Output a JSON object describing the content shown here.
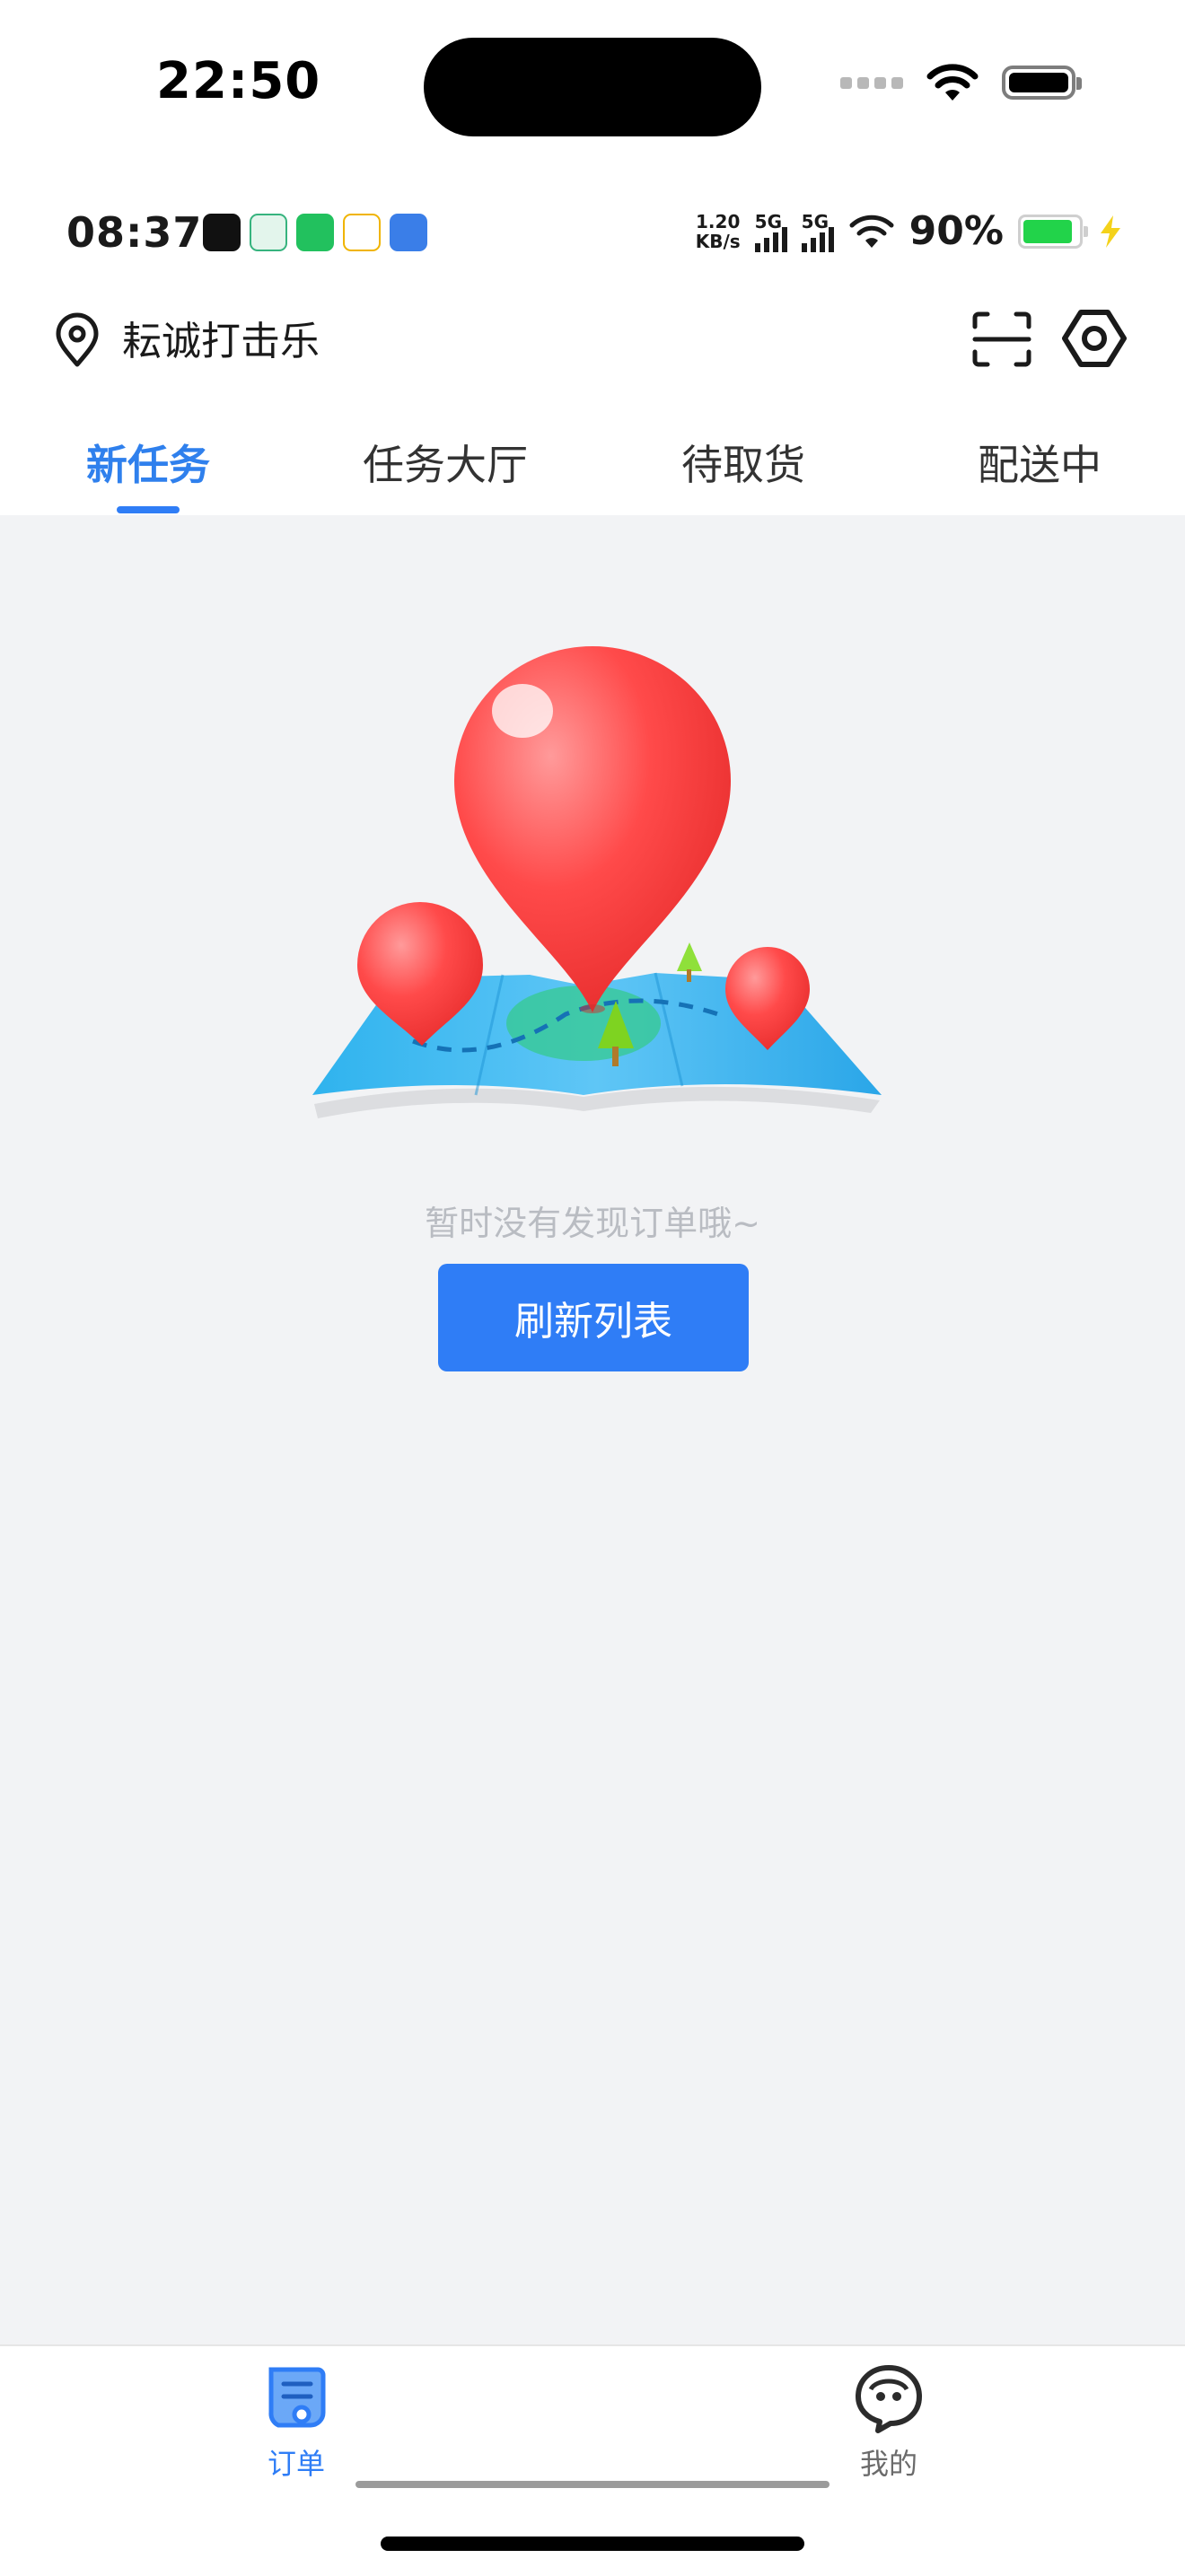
{
  "ios_status": {
    "time": "22:50"
  },
  "android_status": {
    "time": "08:37",
    "app_icons": [
      {
        "name": "douyin-icon",
        "color": "#111111"
      },
      {
        "name": "home-app-icon",
        "color": "#e8f6ef"
      },
      {
        "name": "wechat-icon",
        "color": "#22c15e"
      },
      {
        "name": "58-app-icon",
        "color": "#f2f2f2"
      },
      {
        "name": "bank-app-icon",
        "color": "#3a7ee8"
      }
    ],
    "net_speed": "1.20",
    "net_unit": "KB/s",
    "sim1": "5G",
    "sim2": "5G",
    "battery": "90%"
  },
  "header": {
    "location": "耘诚打击乐"
  },
  "tabs": [
    {
      "label": "新任务",
      "active": true
    },
    {
      "label": "任务大厅",
      "active": false
    },
    {
      "label": "待取货",
      "active": false
    },
    {
      "label": "配送中",
      "active": false
    }
  ],
  "empty_state": {
    "message": "暂时没有发现订单哦~",
    "button": "刷新列表"
  },
  "tabbar": {
    "items": [
      {
        "label": "订单",
        "active": true
      },
      {
        "label": "我的",
        "active": false
      }
    ]
  },
  "colors": {
    "accent": "#2f7df6",
    "background": "#f2f3f5"
  }
}
